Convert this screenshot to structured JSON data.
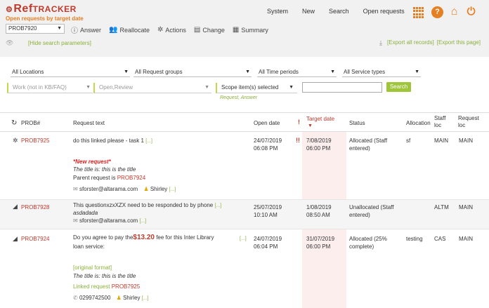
{
  "app": {
    "logo_prefix": "Ref",
    "logo_suffix": "TRACKER",
    "subtitle": "Open requests by target date"
  },
  "nav": [
    "System",
    "New",
    "Search",
    "Open requests"
  ],
  "toolbar": {
    "prob_select": "PROB7920",
    "answer": "Answer",
    "reallocate": "Reallocate",
    "actions": "Actions",
    "change": "Change",
    "summary": "Summary"
  },
  "filter_bar": {
    "hide_link": "[Hide search parameters]",
    "export_all": "[Export all records]",
    "export_page": "[Export this page]"
  },
  "filters": {
    "locations": "All Locations",
    "request_groups": "All Request groups",
    "time_periods": "All Time periods",
    "service_types": "All Service types",
    "work": "Work (not in KB/FAQ)",
    "status": "Open,Review",
    "scope": "Scope item(s) selected",
    "scope_sub": "Request, Answer",
    "search_button": "Search"
  },
  "table": {
    "headers": {
      "prob": "PROB#",
      "request": "Request text",
      "open_date": "Open date",
      "target_date": "Target date",
      "status": "Status",
      "allocation": "Allocation",
      "staff_loc": "Staff\nloc",
      "request_loc": "Request\nloc"
    },
    "rows": [
      {
        "prob": "PROB7925",
        "text": "do this linked please - task 1",
        "more": "[...]",
        "new_request": "*New request*",
        "title_line": "The title is: this is the title",
        "parent_text": "Parent request is ",
        "parent_link": "PROB7924",
        "email": "sforster@altarama.com",
        "person": "Shirley",
        "person_more": "[...]",
        "open_date": "24/07/2019",
        "open_time": "06:08 PM",
        "overdue_mark": "!!",
        "target_date": "7/08/2019",
        "target_time": "06:00 PM",
        "status": "Allocated (Staff entered)",
        "allocation": "sf",
        "staff_loc": "MAIN",
        "request_loc": "MAIN"
      },
      {
        "prob": "PROB7928",
        "text": "This questionxzxXZX need to be responded to by phone",
        "more": "[...]",
        "sub_text": "asdadada",
        "email": "sforster@altarama.com",
        "email_more": "[...]",
        "open_date": "25/07/2019",
        "open_time": "10:10 AM",
        "target_date": "1/08/2019",
        "target_time": "08:50 AM",
        "status": "Unallocated (Staff entered)",
        "allocation": "",
        "staff_loc": "ALTM",
        "request_loc": "MAIN"
      },
      {
        "prob": "PROB7924",
        "text_a": "Do you agree to pay the",
        "price": "$13.20",
        "text_b": " fee for this Inter Library",
        "text_c": "loan service:",
        "more": "[...]",
        "original_format": "[original format]",
        "title_line": "The title is: this is the title",
        "linked_text": "Linked request ",
        "linked_link": "PROB7925",
        "phone": "0299742500",
        "person": "Shirley",
        "person_more": "[...]",
        "open_date": "24/07/2019",
        "open_time": "06:04 PM",
        "target_date": "31/07/2019",
        "target_time": "06:00 PM",
        "status": "Allocated (25% complete)",
        "allocation": "testing",
        "staff_loc": "CAS",
        "request_loc": "MAIN"
      }
    ]
  }
}
